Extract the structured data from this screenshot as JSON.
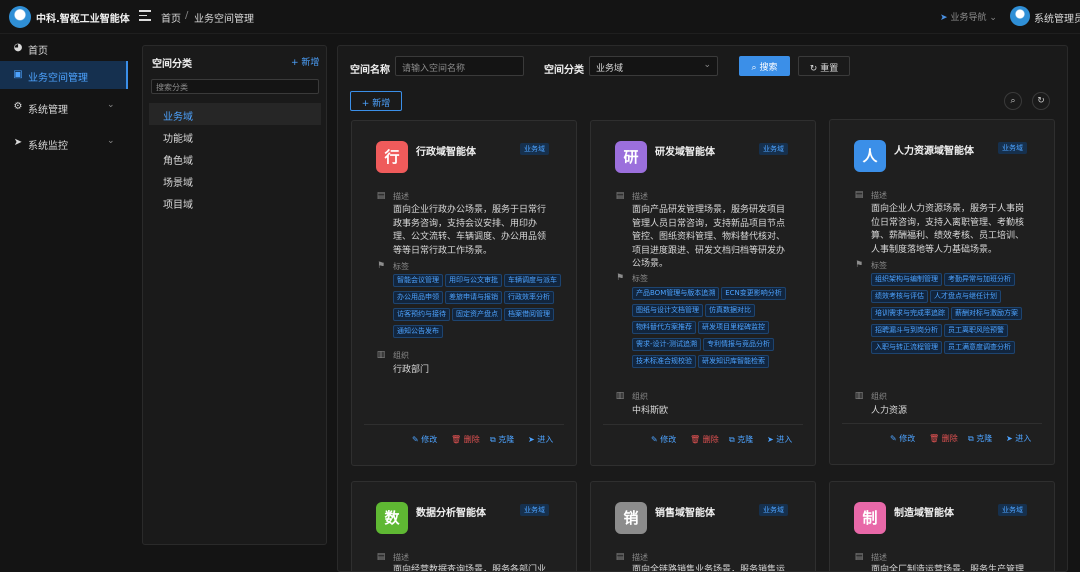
{
  "header": {
    "app_title": "中科.智枢工业智能体",
    "breadcrumb_home": "首页",
    "breadcrumb_sep": "/",
    "breadcrumb_current": "业务空间管理",
    "biz_nav": "业务导航",
    "admin_name": "系统管理员"
  },
  "sidebar": {
    "items": [
      {
        "label": "首页",
        "icon": "dashboard-icon"
      },
      {
        "label": "业务空间管理",
        "icon": "space-icon"
      },
      {
        "label": "系统管理",
        "icon": "gear-icon"
      },
      {
        "label": "系统监控",
        "icon": "send-icon"
      }
    ]
  },
  "category": {
    "title": "空间分类",
    "add_label": "+ 新增",
    "search_placeholder": "搜索分类",
    "items": [
      "业务域",
      "功能域",
      "角色域",
      "场景域",
      "项目域"
    ]
  },
  "filter": {
    "name_label": "空间名称",
    "name_placeholder": "请输入空间名称",
    "category_label": "空间分类",
    "category_value": "业务域",
    "search_label": "搜索",
    "reset_label": "重置",
    "add_label": "+ 新增"
  },
  "card_labels": {
    "desc": "描述",
    "tags": "标签",
    "org": "组织",
    "edit": "修改",
    "delete": "删除",
    "copy": "克隆",
    "enter": "进入"
  },
  "cards": [
    {
      "avatar": "行",
      "color": "#ef5b5b",
      "name": "行政域智能体",
      "badge": "业务域",
      "desc": "面向企业行政办公场景，服务于日常行政事务咨询，支持会议安排、用印办理、公文流转、车辆调度、办公用品领等等日常行政工作场景。",
      "tags": [
        "智能会议管理",
        "用印与公文审批",
        "车辆调度与派车",
        "办公用品申领",
        "差旅申请与报销",
        "行政效率分析",
        "访客预约与接待",
        "固定资产盘点",
        "档案借阅管理",
        "通知公告发布"
      ],
      "org": "行政部门"
    },
    {
      "avatar": "研",
      "color": "#9b6fdc",
      "name": "研发域智能体",
      "badge": "业务域",
      "desc": "面向产品研发管理场景，服务研发项目管理人员日常咨询，支持新品项目节点管控、图纸资料管理、物料替代核对、项目进度跟进、研发文档归档等研发办公场景。",
      "tags": [
        "产品BOM管理与版本追溯",
        "ECN变更影响分析",
        "图纸与设计文档管理",
        "仿真数据对比",
        "物料替代方案推荐",
        "研发项目里程碑监控",
        "需求-设计-测试追溯",
        "专利情报与竞品分析",
        "技术标准合规校验",
        "研发知识库智能检索"
      ],
      "org": "中科斯欧"
    },
    {
      "avatar": "人",
      "color": "#3b8fe8",
      "name": "人力资源域智能体",
      "badge": "业务域",
      "desc": "面向企业人力资源场景，服务于人事岗位日常咨询，支持入离职管理、考勤核算、薪酬福利、绩效考核、员工培训、人事制度落地等人力基础场景。",
      "tags": [
        "组织架构与编制管理",
        "考勤异常与加班分析",
        "绩效考核与评估",
        "人才盘点与继任计划",
        "培训需求与完成率追踪",
        "薪酬对标与激励方案",
        "招聘漏斗与到岗分析",
        "员工离职风险预警",
        "入职与转正流程管理",
        "员工满意度调查分析"
      ],
      "org": "人力资源"
    },
    {
      "avatar": "数",
      "color": "#5fb833",
      "name": "数据分析智能体",
      "badge": "业务域",
      "desc": "面向经营数据查询场景，服务各部门业",
      "tags": [],
      "org": ""
    },
    {
      "avatar": "销",
      "color": "#8c8c8c",
      "name": "销售域智能体",
      "badge": "业务域",
      "desc": "面向全链路销售业务场景，服务销售运",
      "tags": [],
      "org": ""
    },
    {
      "avatar": "制",
      "color": "#e868a8",
      "name": "制造域智能体",
      "badge": "业务域",
      "desc": "面向全厂制造运营场景，服务生产管理",
      "tags": [],
      "org": ""
    }
  ]
}
